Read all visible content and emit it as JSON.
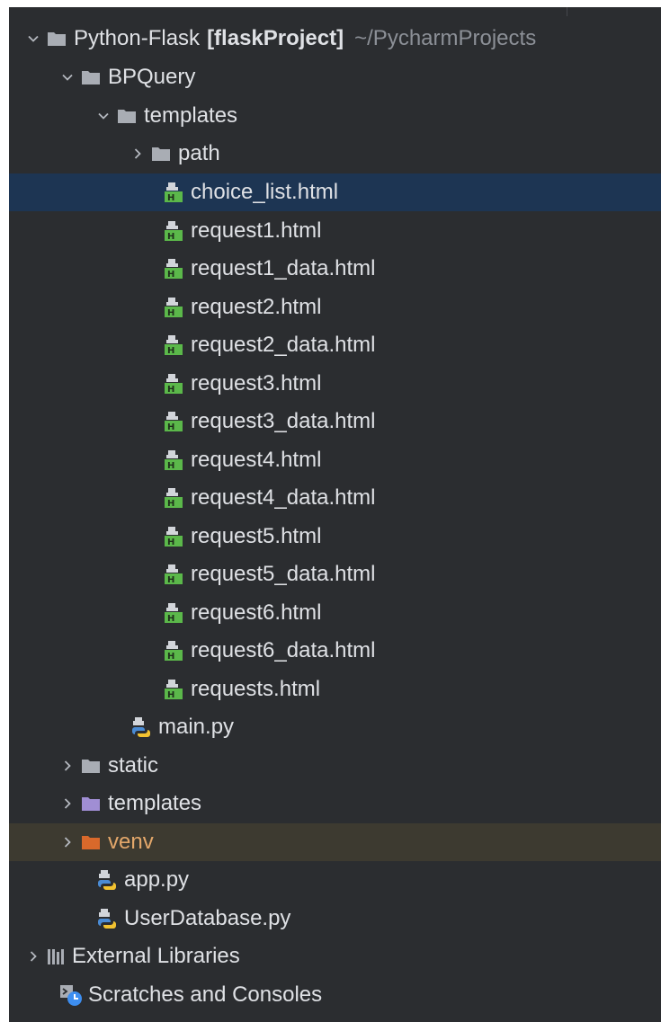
{
  "project": {
    "name": "Python-Flask",
    "module": "[flaskProject]",
    "path": "~/PycharmProjects"
  },
  "folders": {
    "bpquery": "BPQuery",
    "templates_inner": "templates",
    "path": "path",
    "static": "static",
    "templates": "templates",
    "venv": "venv"
  },
  "html_files": [
    "choice_list.html",
    "request1.html",
    "request1_data.html",
    "request2.html",
    "request2_data.html",
    "request3.html",
    "request3_data.html",
    "request4.html",
    "request4_data.html",
    "request5.html",
    "request5_data.html",
    "request6.html",
    "request6_data.html",
    "requests.html"
  ],
  "py_files": {
    "main": "main.py",
    "app": "app.py",
    "userdb": "UserDatabase.py"
  },
  "root_items": {
    "external": "External Libraries",
    "scratches": "Scratches and Consoles"
  },
  "colors": {
    "background": "#2b2d30",
    "selection": "#1d3553",
    "excluded_row": "#3d3a30",
    "folder_gray": "#a9adb4",
    "folder_resource": "#a08ed4",
    "folder_excluded": "#d9692b",
    "html_icon": "#5bb84a"
  }
}
